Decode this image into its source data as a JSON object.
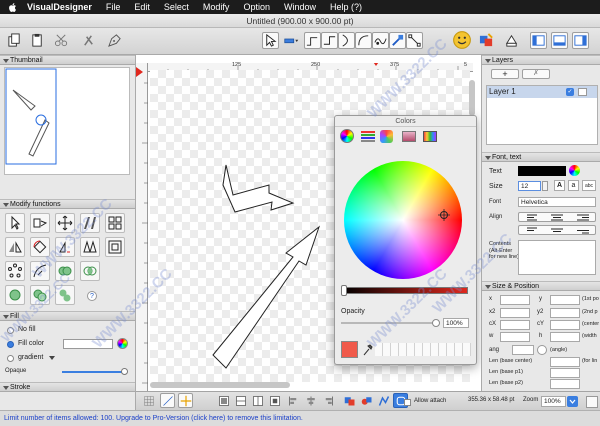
{
  "menubar": {
    "app_name": "VisualDesigner",
    "items": [
      "File",
      "Edit",
      "Select",
      "Modify",
      "Option",
      "Window",
      "Help (?)"
    ]
  },
  "window": {
    "title": "Untitled (900.00 x 900.00 pt)"
  },
  "left_panel": {
    "thumbnail_title": "Thumbnail",
    "modify_title": "Modify functions",
    "fill_title": "Fill",
    "no_fill_label": "No fill",
    "fill_color_label": "Fill color",
    "gradient_label": "gradient",
    "opacity_label": "Opaque",
    "stroke_title": "Stroke",
    "help_label": "?"
  },
  "ruler": {
    "ticks": [
      "125",
      "250",
      "375",
      "5"
    ]
  },
  "colors_window": {
    "title": "Colors",
    "opacity_label": "Opacity",
    "opacity_value": "100%",
    "swatch_color": "#f05a4b"
  },
  "right_panel": {
    "layers_title": "Layers",
    "add_label": "+",
    "remove_label": "✗",
    "layer_name": "Layer 1",
    "font_title": "Font, text",
    "text_label": "Text",
    "size_label": "Size",
    "size_value": "12",
    "font_label": "Font",
    "font_value": "Helvetica",
    "align_label": "Align",
    "contents_label": "Contents (Alt-Enter for new line)",
    "size_pos_title": "Size & Position",
    "fields": {
      "x": "x",
      "y": "y",
      "x2": "x2",
      "y2": "y2",
      "cx": "cX",
      "cy": "cY",
      "w": "w",
      "h": "h",
      "p1": "(1st po",
      "p2": "(2nd p",
      "center": "(center",
      "width": "(width",
      "ang": "ang",
      "angle": "(angle)",
      "len_center": "Len (base center)",
      "len_p1": "Len (base p1)",
      "len_p2": "Len (base p2)",
      "for_lin": "(for lin"
    }
  },
  "bottom": {
    "allow_attach_label": "Allow attach",
    "dimensions": "355.36 x 58.48 pt",
    "zoom_label": "Zoom",
    "zoom_value": "100%"
  },
  "status": {
    "message": "Limit number of items allowed: 100. Upgrade to Pro-Version (click here) to remove this limitation."
  },
  "watermark": {
    "text": "WWW.3322.CC"
  }
}
